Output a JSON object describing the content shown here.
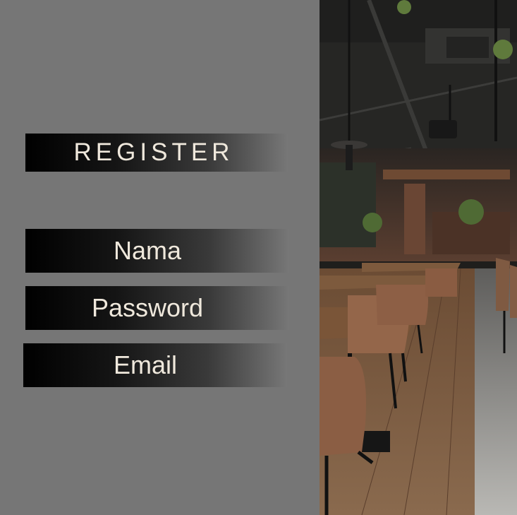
{
  "form": {
    "title": "REGISTER",
    "fields": [
      {
        "label": "Nama"
      },
      {
        "label": "Password"
      },
      {
        "label": "Email"
      }
    ]
  },
  "photo": {
    "icon": "restaurant-interior-photo"
  },
  "colors": {
    "panel": "#767676",
    "bar_dark": "#000000",
    "text": "#efe8dc"
  }
}
